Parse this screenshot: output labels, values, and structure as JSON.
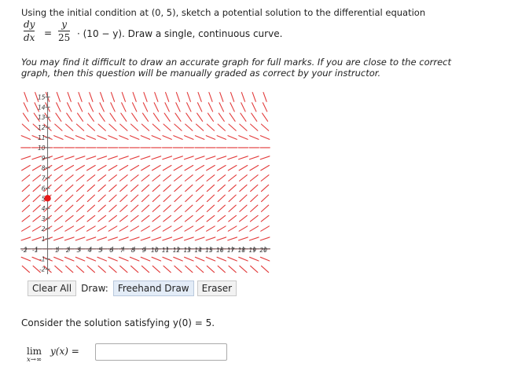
{
  "question": {
    "intro": "Using the initial condition at (0, 5), sketch a potential solution to the differential equation",
    "dydx_num": "dy",
    "dydx_den": "dx",
    "y_num": "y",
    "y_den": "25",
    "rhs_tail": "· (10 − y). Draw a single, continuous curve.",
    "note": "You may find it difficult to draw an accurate graph for full marks. If you are close to the correct graph, then this question will be manually graded as correct by your instructor."
  },
  "graph": {
    "x_ticks": [
      "-2",
      "-1",
      "1",
      "2",
      "3",
      "4",
      "5",
      "6",
      "7",
      "8",
      "9",
      "10",
      "11",
      "12",
      "13",
      "14",
      "15",
      "16",
      "17",
      "18",
      "19",
      "20"
    ],
    "y_ticks": [
      "15",
      "14",
      "13",
      "12",
      "11",
      "10",
      "9",
      "8",
      "7",
      "6",
      "5",
      "4",
      "3",
      "2",
      "1",
      "-1",
      "-2"
    ],
    "x_range": [
      -2.5,
      20.5
    ],
    "y_range": [
      -2.5,
      15.5
    ],
    "initial_point": {
      "x": 0,
      "y": 5
    },
    "field": {
      "k": 25,
      "cap": 10,
      "x_step": 1,
      "y_step": 1
    },
    "arrow_color": "#e23b3b",
    "point_color": "#e8191a"
  },
  "toolbar": {
    "clear_label": "Clear All",
    "draw_label": "Draw:",
    "freehand_label": "Freehand Draw",
    "eraser_label": "Eraser"
  },
  "consider": {
    "text": "Consider the solution satisfying y(0) = 5."
  },
  "limit": {
    "lim": "lim",
    "sub": "x→∞",
    "expr": "y(x) =",
    "answer_value": ""
  }
}
